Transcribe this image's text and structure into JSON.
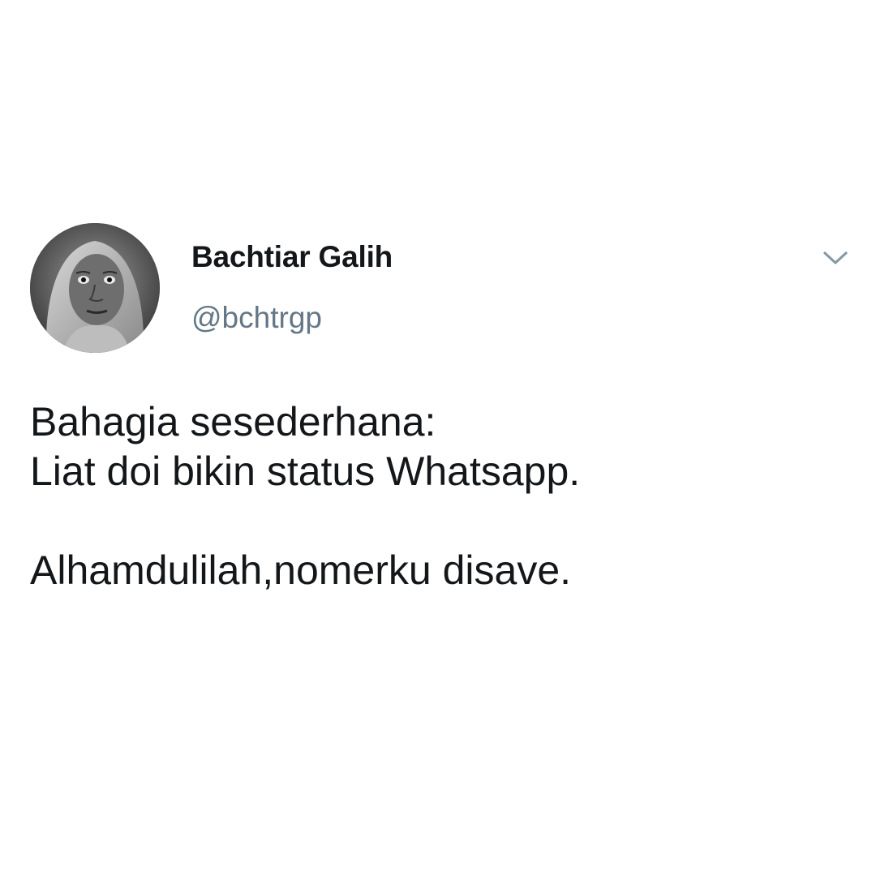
{
  "author": {
    "display_name": "Bachtiar Galih",
    "handle": "@bchtrgp",
    "avatar_icon": "profile-photo"
  },
  "menu": {
    "icon": "chevron-down-icon",
    "color": "#8899a6"
  },
  "tweet": {
    "lines": [
      "Bahagia sesederhana:",
      "Liat doi bikin status Whatsapp."
    ],
    "closing_line": "Alhamdulilah,nomerku disave."
  },
  "colors": {
    "background": "#ffffff",
    "name": "#14171a",
    "handle": "#657786",
    "text": "#14171a"
  }
}
